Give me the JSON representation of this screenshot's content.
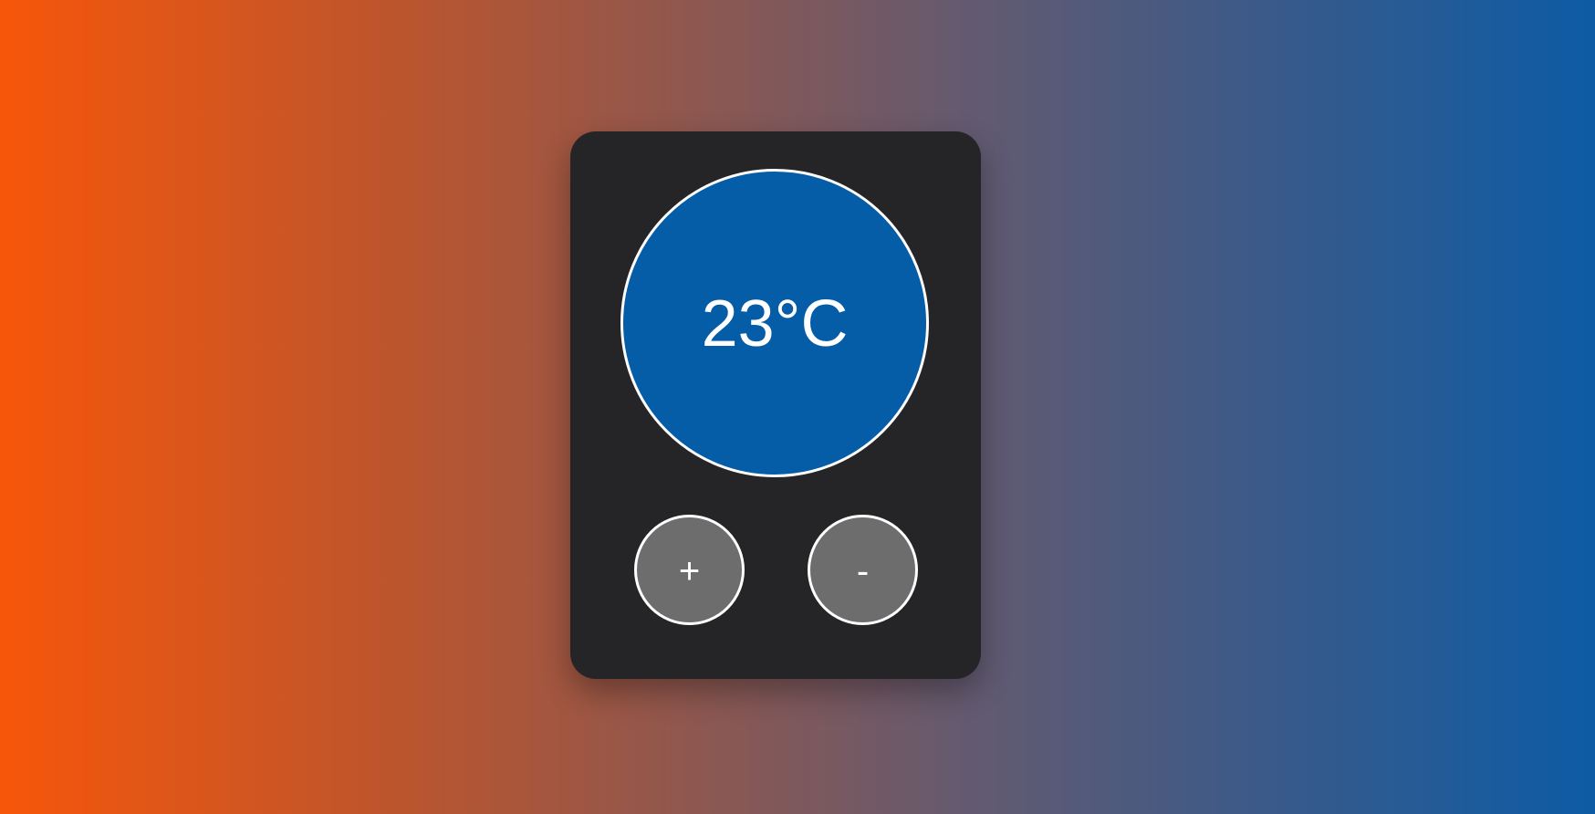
{
  "thermostat": {
    "temperature_label": "23°C",
    "buttons": {
      "increase_label": "+",
      "decrease_label": "-"
    }
  },
  "colors": {
    "background_left": "#f7560a",
    "background_right": "#0d5ba5",
    "panel": "#252527",
    "temperature_circle": "#055ca7",
    "button": "#6d6d6d",
    "outline": "#ffffff"
  },
  "icons": {
    "increase": "plus-icon",
    "decrease": "minus-icon"
  }
}
